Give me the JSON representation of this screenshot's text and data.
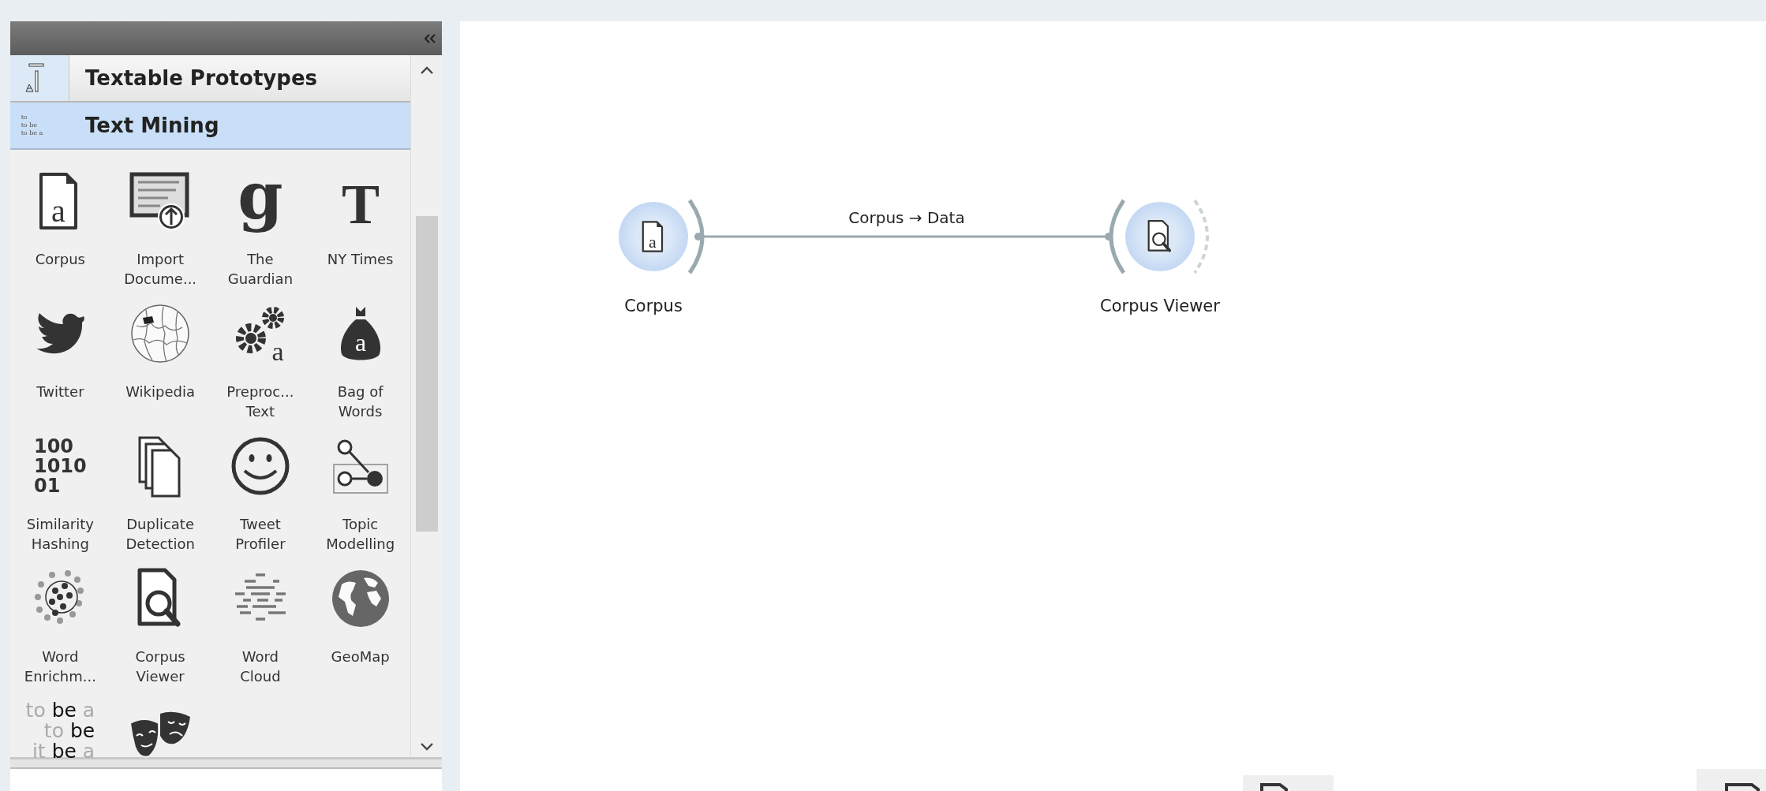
{
  "sidebar": {
    "categories": [
      {
        "label": "Textable Prototypes",
        "selected": false,
        "kind": "textable"
      },
      {
        "label": "Text Mining",
        "selected": true,
        "kind": "textmining",
        "icon_text": [
          "to",
          "to be",
          "to be a"
        ]
      }
    ],
    "widgets": [
      {
        "label": "Corpus",
        "kind": "document",
        "icon_text": [
          "a"
        ]
      },
      {
        "label": "Import\nDocume...",
        "kind": "upload"
      },
      {
        "label": "The\nGuardian",
        "kind": "serifletter",
        "icon_text": [
          "g"
        ]
      },
      {
        "label": "NY Times",
        "kind": "letter",
        "icon_text": [
          "T"
        ]
      },
      {
        "label": "Twitter",
        "kind": "bird"
      },
      {
        "label": "Wikipedia",
        "kind": "puzzleglobe"
      },
      {
        "label": "Preproc...\nText",
        "kind": "gears",
        "icon_text": [
          "a"
        ]
      },
      {
        "label": "Bag of\nWords",
        "kind": "bag",
        "icon_text": [
          "a"
        ]
      },
      {
        "label": "Similarity\nHashing",
        "kind": "binary",
        "icon_text": [
          "100",
          "1010",
          "01"
        ]
      },
      {
        "label": "Duplicate\nDetection",
        "kind": "documents"
      },
      {
        "label": "Tweet\nProfiler",
        "kind": "smiley"
      },
      {
        "label": "Topic\nModelling",
        "kind": "graph"
      },
      {
        "label": "Word\nEnrichm...",
        "kind": "dots"
      },
      {
        "label": "Corpus\nViewer",
        "kind": "viewer"
      },
      {
        "label": "Word\nCloud",
        "kind": "lines"
      },
      {
        "label": "GeoMap",
        "kind": "globe"
      },
      {
        "kind": "words",
        "icon_text": [
          "to **be** a",
          "to **be**",
          "it **be** a"
        ]
      },
      {
        "kind": "masks"
      }
    ]
  },
  "canvas": {
    "nodes": [
      {
        "label": "Corpus",
        "kind": "corpus",
        "icon_text": "a"
      },
      {
        "label": "Corpus Viewer",
        "kind": "viewer"
      }
    ],
    "links": [
      {
        "label": "Corpus → Data"
      }
    ]
  }
}
